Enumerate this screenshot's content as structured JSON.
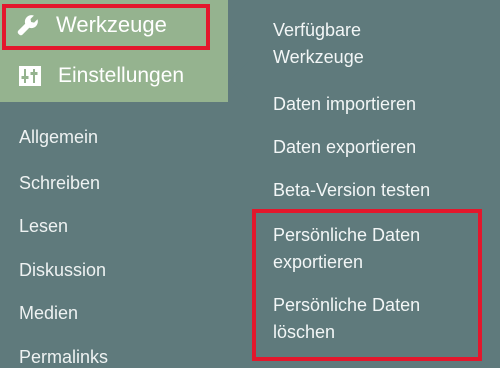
{
  "menu": {
    "tools_label": "Werkzeuge",
    "tools_icon": "wrench-icon",
    "settings_label": "Einstellungen",
    "settings_icon": "sliders-icon",
    "settings_items": [
      {
        "label": "Allgemein"
      },
      {
        "label": "Schreiben"
      },
      {
        "label": "Lesen"
      },
      {
        "label": "Diskussion"
      },
      {
        "label": "Medien"
      },
      {
        "label": "Permalinks"
      }
    ]
  },
  "flyout": {
    "items": [
      {
        "line1": "Verfügbare",
        "line2": "Werkzeuge"
      },
      {
        "line1": "Daten importieren",
        "line2": ""
      },
      {
        "line1": "Daten exportieren",
        "line2": ""
      },
      {
        "line1": "Beta-Version testen",
        "line2": ""
      },
      {
        "line1": "Persönliche Daten",
        "line2": "exportieren"
      },
      {
        "line1": "Persönliche Daten",
        "line2": "löschen"
      }
    ]
  },
  "colors": {
    "menu_bg": "#5f7a7c",
    "active_bg": "#95b38f",
    "highlight": "#e3172c",
    "text": "#ffffff"
  }
}
